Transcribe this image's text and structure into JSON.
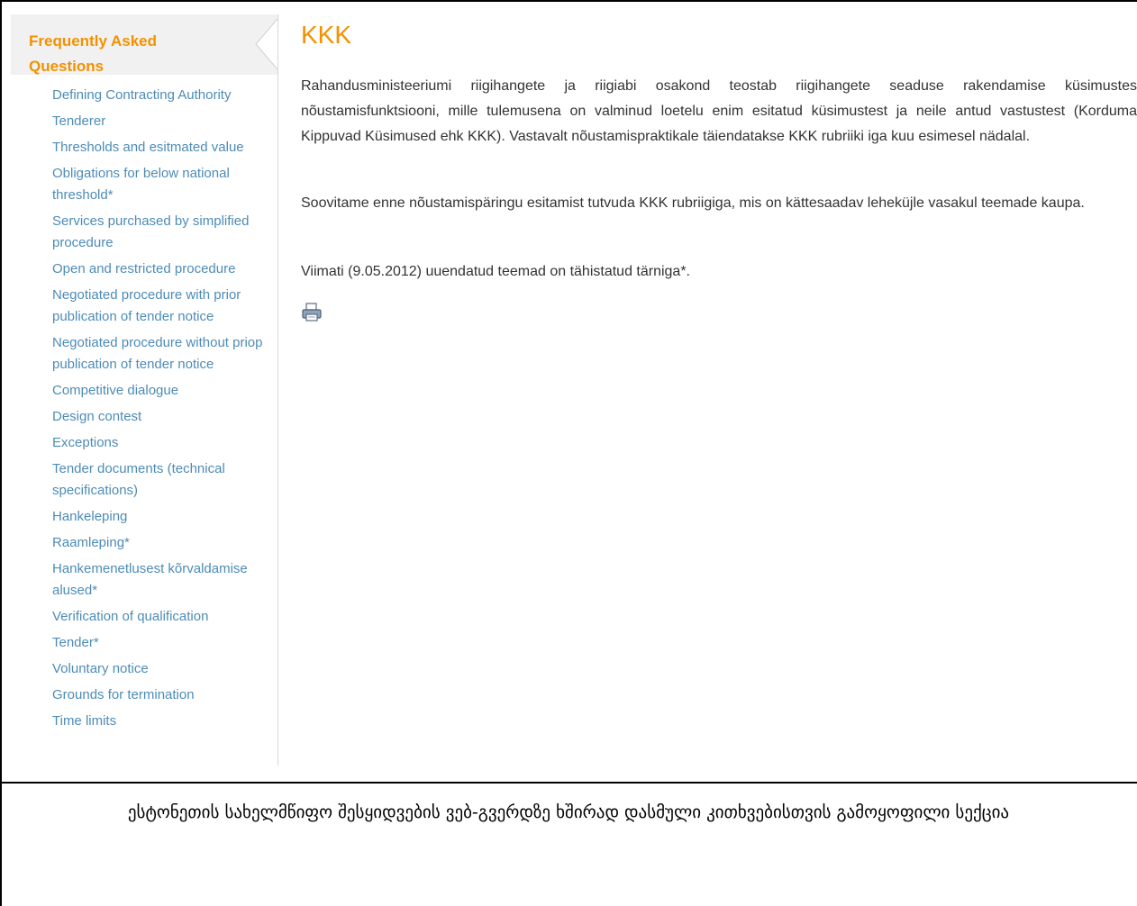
{
  "sidebar": {
    "title": "Frequently Asked Questions",
    "items": [
      "Defining Contracting Authority",
      "Tenderer",
      "Thresholds and esitmated value",
      "Obligations for below national threshold*",
      "Services purchased by simplified procedure",
      "Open and restricted procedure",
      "Negotiated procedure with prior publication of tender notice",
      "Negotiated procedure without priop publication of tender notice",
      "Competitive dialogue",
      "Design contest",
      "Exceptions",
      "Tender documents (technical specifications)",
      "Hankeleping",
      "Raamleping*",
      "Hankemenetlusest kõrvaldamise alused*",
      "Verification of qualification",
      "Tender*",
      "Voluntary notice",
      "Grounds for termination",
      "Time limits"
    ]
  },
  "content": {
    "title": "KKK",
    "paragraph1": "Rahandusministeeriumi riigihangete ja riigiabi osakond teostab riigihangete seaduse rakendamise küsimustes nõustamisfunktsiooni, mille tulemusena on valminud loetelu enim esitatud küsimustest ja neile antud vastustest (Korduma Kippuvad Küsimused ehk KKK). Vastavalt nõustamispraktikale täiendatakse KKK rubriiki iga kuu esimesel nädalal.",
    "paragraph2": "Soovitame enne nõustamispäringu esitamist tutvuda KKK rubriigiga, mis on kättesaadav leheküjle vasakul teemade kaupa.",
    "paragraph3": "Viimati (9.05.2012) uuendatud teemad on tähistatud tärniga*.",
    "print_icon": "printer-icon"
  },
  "caption": {
    "text": "ესტონეთის სახელმწიფო შესყიდვების ვებ-გვერდზე ხშირად დასმული კითხვებისთვის გამოყოფილი სექცია"
  },
  "colors": {
    "accent": "#f29200",
    "link": "#4d8cb7",
    "text": "#333333",
    "sidebar_head_bg": "#f1f1f1"
  }
}
